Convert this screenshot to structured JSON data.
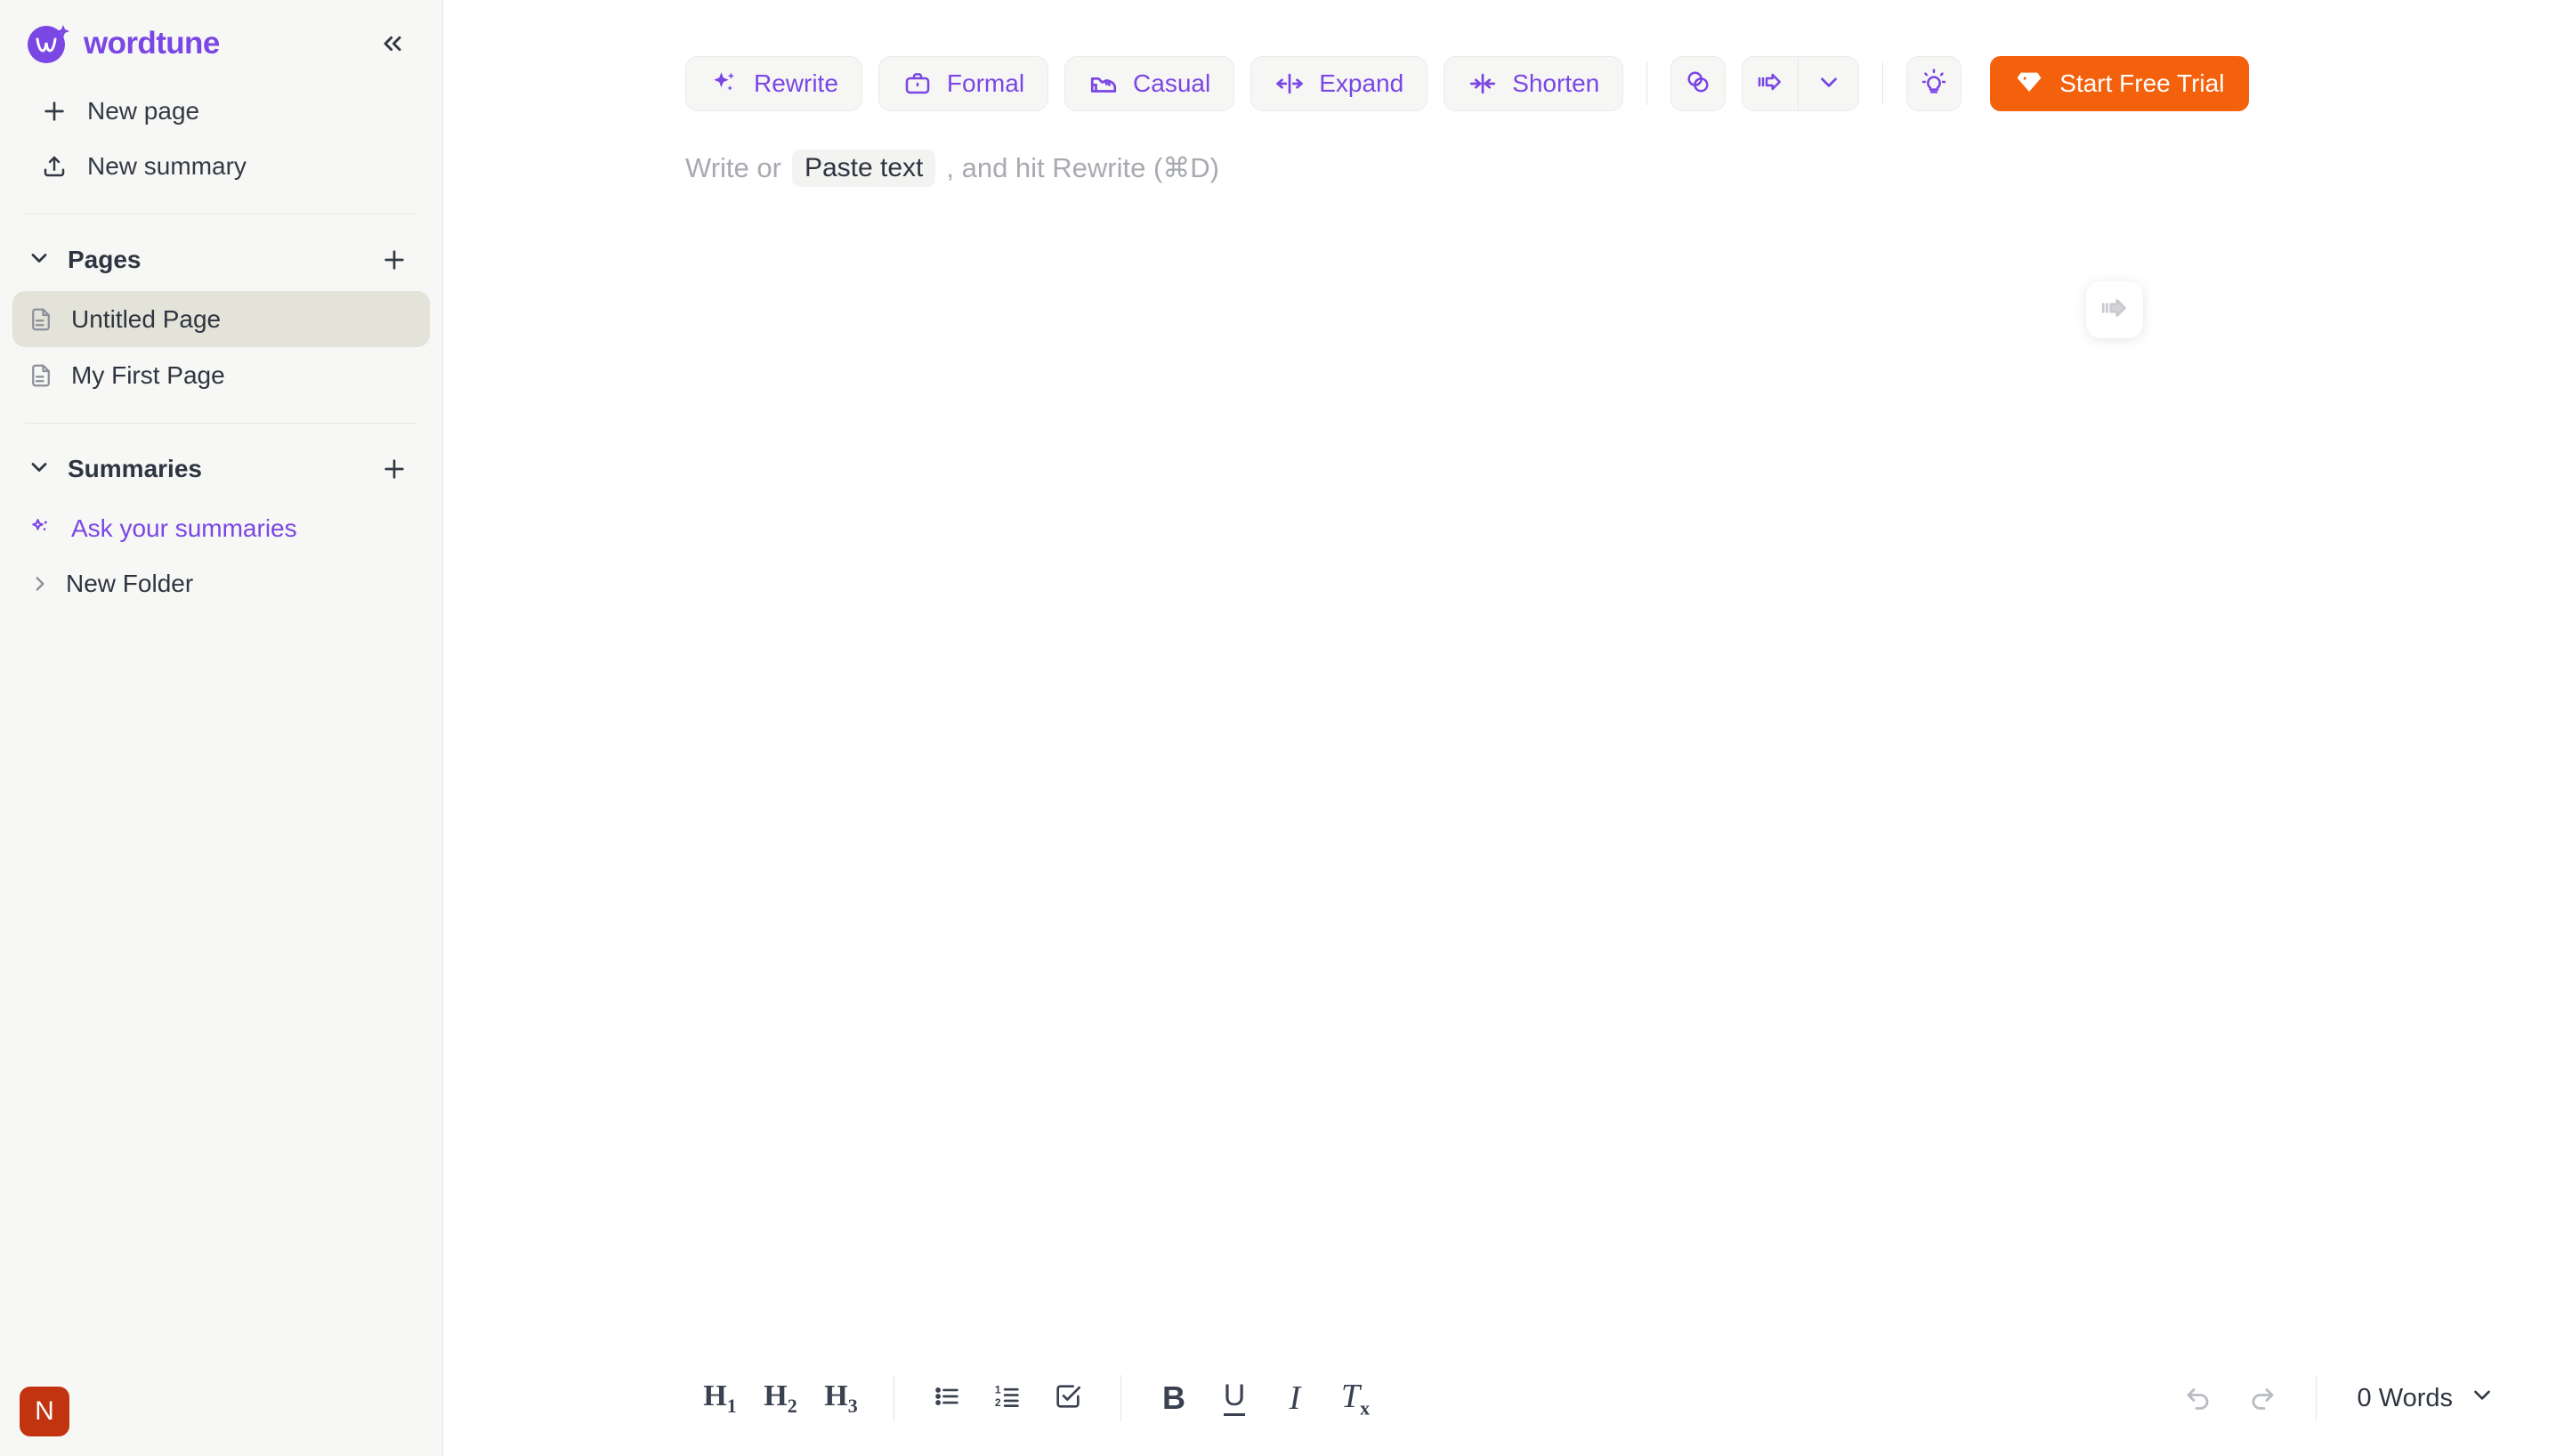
{
  "brand": {
    "name": "wordtune",
    "logo_icon": "wordtune-logo-icon",
    "collapse_icon": "chevrons-left-icon"
  },
  "sidebar": {
    "actions": [
      {
        "label": "New page",
        "icon": "plus-icon"
      },
      {
        "label": "New summary",
        "icon": "upload-icon"
      }
    ],
    "pages_section": {
      "title": "Pages",
      "chevron_icon": "chevron-down-icon",
      "add_icon": "plus-icon"
    },
    "pages": [
      {
        "label": "Untitled Page",
        "icon": "document-icon",
        "selected": true
      },
      {
        "label": "My First Page",
        "icon": "document-icon",
        "selected": false
      }
    ],
    "summaries_section": {
      "title": "Summaries",
      "chevron_icon": "chevron-down-icon",
      "add_icon": "plus-icon"
    },
    "summaries": [
      {
        "label": "Ask your summaries",
        "icon": "sparkles-icon",
        "accent": true
      }
    ],
    "folder": {
      "label": "New Folder",
      "icon": "chevron-right-icon"
    },
    "avatar": {
      "initial": "N",
      "color": "#c1340f"
    }
  },
  "toolbar": {
    "buttons": [
      {
        "label": "Rewrite",
        "icon": "sparkles-icon"
      },
      {
        "label": "Formal",
        "icon": "briefcase-icon"
      },
      {
        "label": "Casual",
        "icon": "sneaker-icon"
      },
      {
        "label": "Expand",
        "icon": "expand-arrows-icon"
      },
      {
        "label": "Shorten",
        "icon": "shorten-arrows-icon"
      }
    ],
    "plagiarism_icon": "overlapping-circles-icon",
    "continue_writing_icon": "continue-arrow-icon",
    "continue_dropdown_icon": "chevron-down-icon",
    "ideas_icon": "lightbulb-icon",
    "cta": {
      "label": "Start Free Trial",
      "icon": "diamond-icon",
      "color": "#f4610c"
    }
  },
  "editor": {
    "placeholder_prefix": "Write or",
    "placeholder_chip": "Paste text",
    "placeholder_suffix": ", and hit Rewrite (⌘D)",
    "float_button_icon": "continue-arrow-icon"
  },
  "bottombar": {
    "headings": [
      {
        "label": "H",
        "sub": "1",
        "name": "heading-1"
      },
      {
        "label": "H",
        "sub": "2",
        "name": "heading-2"
      },
      {
        "label": "H",
        "sub": "3",
        "name": "heading-3"
      }
    ],
    "lists": [
      {
        "icon": "bullet-list-icon"
      },
      {
        "icon": "numbered-list-icon"
      },
      {
        "icon": "checklist-icon"
      }
    ],
    "formats": [
      {
        "glyph": "B",
        "name": "bold"
      },
      {
        "glyph": "U",
        "name": "underline"
      },
      {
        "glyph": "I",
        "name": "italic"
      },
      {
        "glyph": "Tx",
        "name": "clear-formatting"
      }
    ],
    "undo_icon": "undo-icon",
    "redo_icon": "redo-icon",
    "word_count": "0 Words",
    "word_count_chevron": "chevron-down-icon"
  }
}
